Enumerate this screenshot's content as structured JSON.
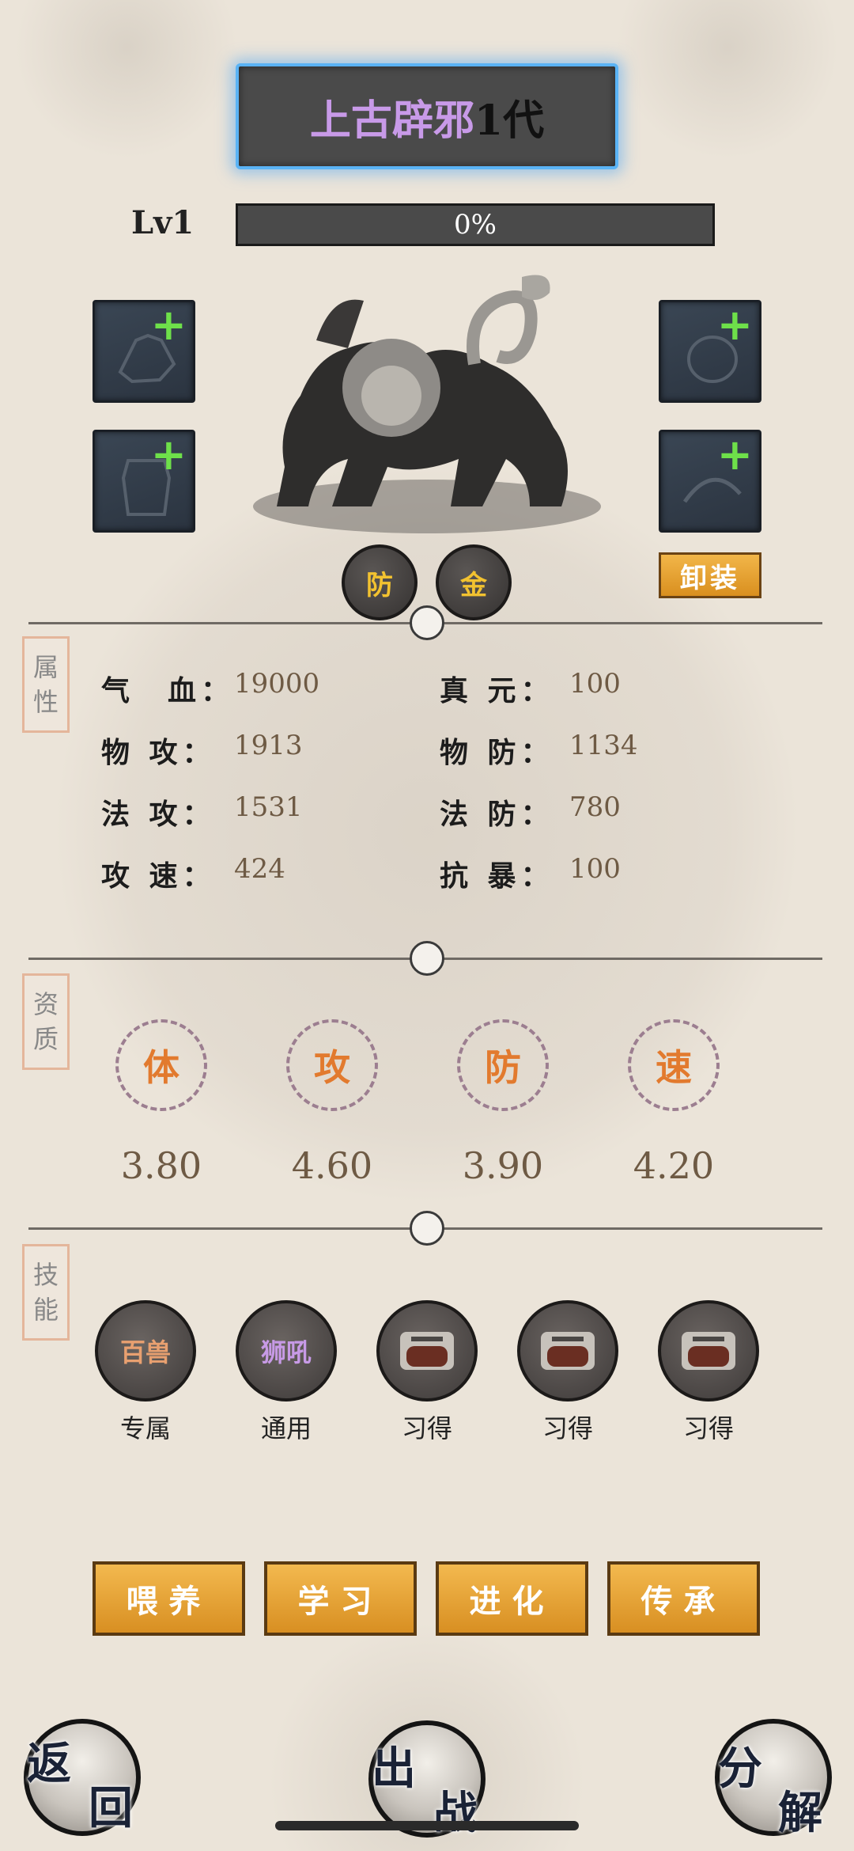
{
  "title": {
    "name": "上古辟邪",
    "generation": "1代"
  },
  "level": {
    "label": "Lv1",
    "exp_text": "0%",
    "exp_fraction": 0
  },
  "pet_tags": [
    "防",
    "金"
  ],
  "unequip_label": "卸装",
  "sections": {
    "attributes_label": [
      "属",
      "性"
    ],
    "aptitude_label": [
      "资",
      "质"
    ],
    "skills_label": [
      "技",
      "能"
    ]
  },
  "attributes": {
    "left": [
      {
        "key": "气　血：",
        "value": "19000"
      },
      {
        "key": "物 攻：",
        "value": "1913"
      },
      {
        "key": "法 攻：",
        "value": "1531"
      },
      {
        "key": "攻 速：",
        "value": "424"
      }
    ],
    "right": [
      {
        "key": "真 元：",
        "value": "100"
      },
      {
        "key": "物 防：",
        "value": "1134"
      },
      {
        "key": "法 防：",
        "value": "780"
      },
      {
        "key": "抗 暴：",
        "value": "100"
      }
    ]
  },
  "aptitude": [
    {
      "label": "体",
      "value": "3.80"
    },
    {
      "label": "攻",
      "value": "4.60"
    },
    {
      "label": "防",
      "value": "3.90"
    },
    {
      "label": "速",
      "value": "4.20"
    }
  ],
  "skills": [
    {
      "name": "百兽",
      "caption": "专属",
      "color": "#e8a070"
    },
    {
      "name": "狮吼",
      "caption": "通用",
      "color": "#c79ae6"
    },
    {
      "name": "",
      "caption": "习得",
      "color": ""
    },
    {
      "name": "",
      "caption": "习得",
      "color": ""
    },
    {
      "name": "",
      "caption": "习得",
      "color": ""
    }
  ],
  "actions": [
    "喂养",
    "学习",
    "进化",
    "传承"
  ],
  "bottom_buttons": {
    "back": [
      "返",
      "回"
    ],
    "battle": [
      "出",
      "战"
    ],
    "decompose": [
      "分",
      "解"
    ]
  },
  "colors": {
    "accent_orange": "#e38f22",
    "title_glow": "#5ab3f5",
    "plus_green": "#6ee04a"
  }
}
